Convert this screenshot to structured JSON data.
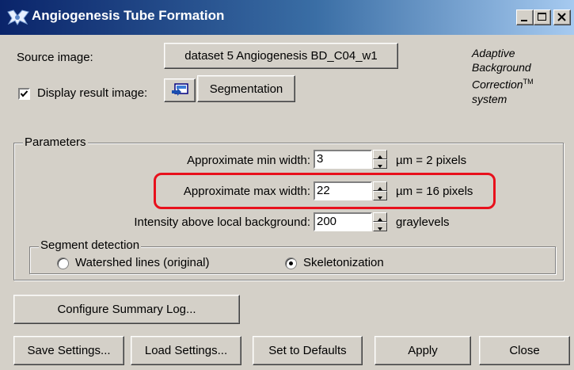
{
  "window": {
    "title": "Angiogenesis Tube Formation",
    "caption_buttons": [
      "minimize-icon",
      "maximize-icon",
      "close-icon"
    ]
  },
  "source": {
    "label": "Source image:",
    "button": "dataset 5 Angiogenesis BD_C04_w1"
  },
  "display": {
    "checkbox_label": "Display result image:",
    "checked": true,
    "icon": "display-image-icon",
    "segmentation_button": "Segmentation"
  },
  "branding": {
    "line1": "Adaptive",
    "line2": "Background",
    "line3": "Correction",
    "tm": "TM",
    "line4": "system"
  },
  "parameters": {
    "title": "Parameters",
    "min_width": {
      "label": "Approximate min width:",
      "value": "3",
      "unit": "µm = 2 pixels"
    },
    "max_width": {
      "label": "Approximate max width:",
      "value": "22",
      "unit": "µm = 16 pixels"
    },
    "intensity": {
      "label": "Intensity above local background:",
      "value": "200",
      "unit": "graylevels"
    }
  },
  "segment_detection": {
    "title": "Segment detection",
    "options": [
      {
        "label": "Watershed lines (original)",
        "selected": false
      },
      {
        "label": "Skeletonization",
        "selected": true
      }
    ]
  },
  "buttons": {
    "configure": "Configure Summary Log...",
    "save": "Save Settings...",
    "load": "Load Settings...",
    "defaults": "Set to Defaults",
    "apply": "Apply",
    "close": "Close"
  },
  "colors": {
    "titlebar_start": "#0a246a",
    "titlebar_end": "#a6caf0",
    "face": "#d4d0c8",
    "highlight": "#e8101c"
  }
}
